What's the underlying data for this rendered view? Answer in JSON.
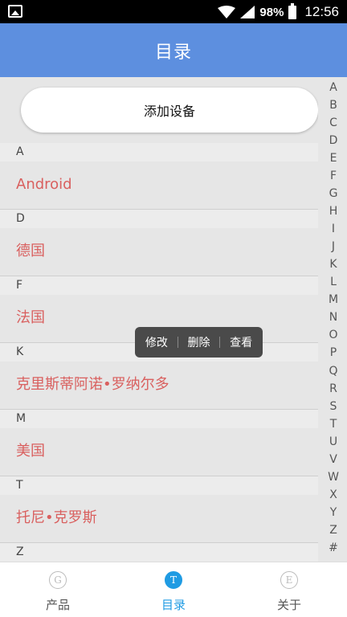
{
  "status_bar": {
    "battery": "98%",
    "time": "12:56",
    "icons": [
      "image-icon",
      "wifi-icon",
      "signal-icon",
      "battery-icon"
    ]
  },
  "header": {
    "title": "目录"
  },
  "add_button": {
    "label": "添加设备"
  },
  "sections": [
    {
      "letter": "A",
      "items": [
        "Android"
      ]
    },
    {
      "letter": "D",
      "items": [
        "德国"
      ]
    },
    {
      "letter": "F",
      "items": [
        "法国"
      ]
    },
    {
      "letter": "K",
      "items": [
        "克里斯蒂阿诺•罗纳尔多"
      ]
    },
    {
      "letter": "M",
      "items": [
        "美国"
      ]
    },
    {
      "letter": "T",
      "items": [
        "托尼•克罗斯"
      ]
    },
    {
      "letter": "Z",
      "items": []
    }
  ],
  "index_letters": [
    "A",
    "B",
    "C",
    "D",
    "E",
    "F",
    "G",
    "H",
    "I",
    "J",
    "K",
    "L",
    "M",
    "N",
    "O",
    "P",
    "Q",
    "R",
    "S",
    "T",
    "U",
    "V",
    "W",
    "X",
    "Y",
    "Z",
    "#"
  ],
  "context_menu": {
    "edit": "修改",
    "delete": "删除",
    "view": "查看"
  },
  "bottom_nav": [
    {
      "label": "产品",
      "icon_letter": "G",
      "icon": "products-icon",
      "active": false
    },
    {
      "label": "目录",
      "icon_letter": "T",
      "icon": "catalog-icon",
      "active": true
    },
    {
      "label": "关于",
      "icon_letter": "E",
      "icon": "about-icon",
      "active": false
    }
  ],
  "colors": {
    "header": "#5d8fdf",
    "item_text": "#d9605f",
    "nav_active": "#1f9be3"
  }
}
